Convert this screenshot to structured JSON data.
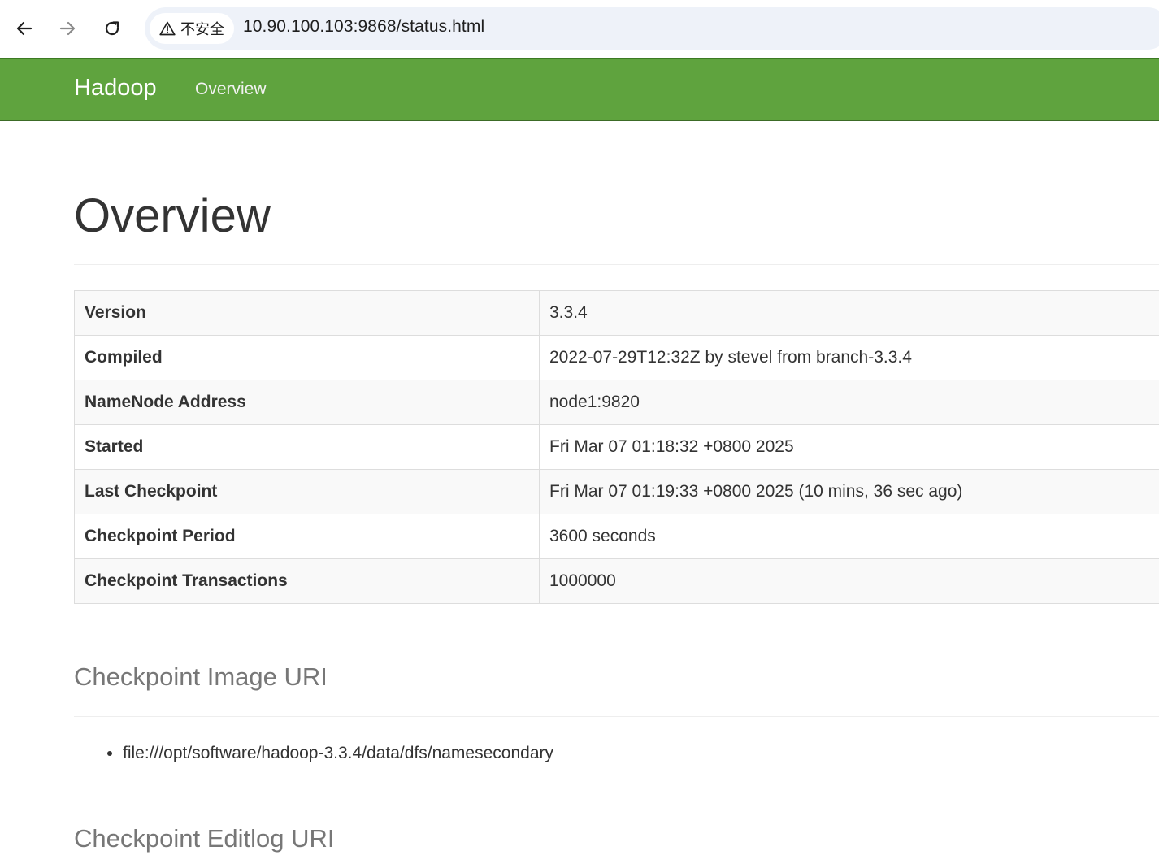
{
  "browser": {
    "security_label": "不安全",
    "url": "10.90.100.103:9868/status.html"
  },
  "navbar": {
    "brand": "Hadoop",
    "links": [
      "Overview"
    ]
  },
  "page": {
    "title": "Overview"
  },
  "overview_table": [
    {
      "label": "Version",
      "value": "3.3.4"
    },
    {
      "label": "Compiled",
      "value": "2022-07-29T12:32Z by stevel from branch-3.3.4"
    },
    {
      "label": "NameNode Address",
      "value": "node1:9820"
    },
    {
      "label": "Started",
      "value": "Fri Mar 07 01:18:32 +0800 2025"
    },
    {
      "label": "Last Checkpoint",
      "value": "Fri Mar 07 01:19:33 +0800 2025 (10 mins, 36 sec ago)"
    },
    {
      "label": "Checkpoint Period",
      "value": "3600 seconds"
    },
    {
      "label": "Checkpoint Transactions",
      "value": "1000000"
    }
  ],
  "checkpoint_image": {
    "heading": "Checkpoint Image URI",
    "uris": [
      "file:///opt/software/hadoop-3.3.4/data/dfs/namesecondary"
    ]
  },
  "checkpoint_editlog": {
    "heading": "Checkpoint Editlog URI"
  },
  "colors": {
    "navbar": "#5fa33e",
    "omnibox": "#eef2f9"
  },
  "icons": [
    "back-arrow-icon",
    "forward-arrow-icon",
    "reload-icon",
    "warning-icon"
  ]
}
